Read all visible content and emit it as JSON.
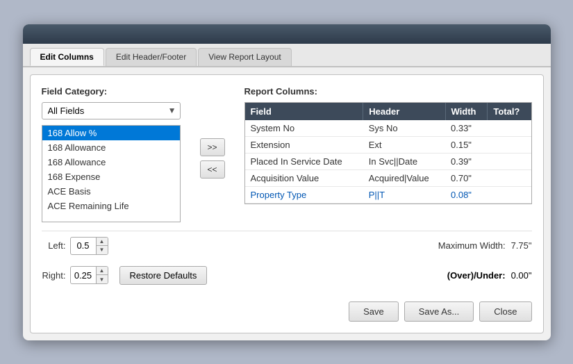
{
  "tabs": [
    {
      "label": "Edit Columns",
      "active": true
    },
    {
      "label": "Edit Header/Footer",
      "active": false
    },
    {
      "label": "View Report Layout",
      "active": false
    }
  ],
  "left": {
    "field_category_label": "Field Category:",
    "dropdown_value": "All Fields",
    "field_list": [
      {
        "label": "168 Allow %",
        "selected": true
      },
      {
        "label": "168 Allowance",
        "selected": false
      },
      {
        "label": "168 Allowance",
        "selected": false
      },
      {
        "label": "168 Expense",
        "selected": false
      },
      {
        "label": "ACE Basis",
        "selected": false
      },
      {
        "label": "ACE Remaining Life",
        "selected": false
      }
    ]
  },
  "arrows": {
    "add": ">>",
    "remove": "<<"
  },
  "right": {
    "report_columns_label": "Report Columns:",
    "table_headers": [
      "Field",
      "Header",
      "Width",
      "Total?"
    ],
    "table_rows": [
      {
        "field": "System No",
        "header": "Sys No",
        "width": "0.33\"",
        "total": ""
      },
      {
        "field": "Extension",
        "header": "Ext",
        "width": "0.15\"",
        "total": ""
      },
      {
        "field": "Placed In Service Date",
        "header": "In Svc||Date",
        "width": "0.39\"",
        "total": ""
      },
      {
        "field": "Acquisition Value",
        "header": "Acquired|Value",
        "width": "0.70\"",
        "total": ""
      },
      {
        "field": "Property Type",
        "header": "P||T",
        "width": "0.08\"",
        "total": ""
      }
    ]
  },
  "margins": {
    "left_label": "Left:",
    "left_value": "0.5",
    "right_label": "Right:",
    "right_value": "0.25",
    "max_width_label": "Maximum Width:",
    "max_width_value": "7.75\"",
    "over_under_label": "(Over)/Under:",
    "over_under_value": "0.00\"",
    "restore_label": "Restore Defaults"
  },
  "footer": {
    "save_label": "Save",
    "save_as_label": "Save As...",
    "close_label": "Close"
  }
}
